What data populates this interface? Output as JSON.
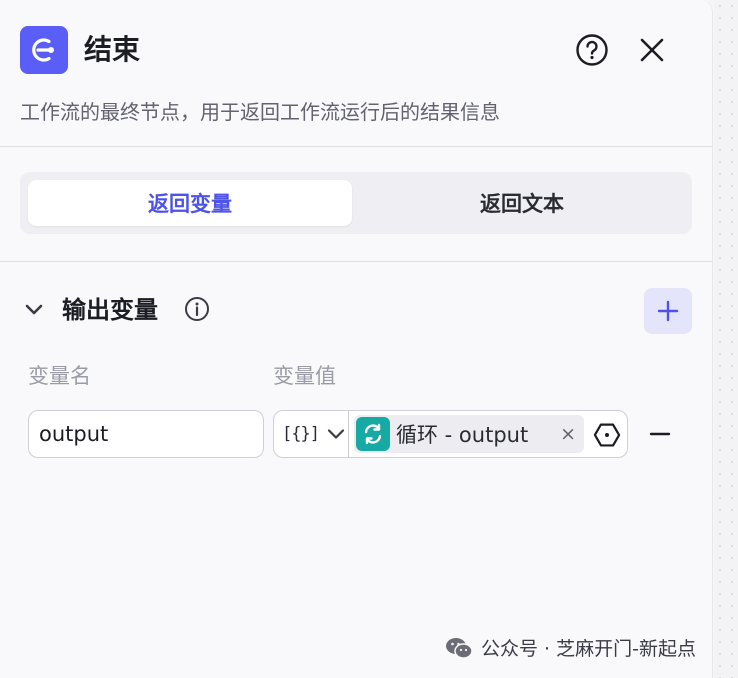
{
  "node": {
    "title": "结束",
    "description": "工作流的最终节点，用于返回工作流运行后的结果信息",
    "icon": "end-node-icon",
    "accent": "#5a5ef6"
  },
  "tabs": [
    {
      "label": "返回变量",
      "active": true
    },
    {
      "label": "返回文本",
      "active": false
    }
  ],
  "output_section": {
    "title": "输出变量",
    "columns": {
      "name": "变量名",
      "value": "变量值"
    },
    "rows": [
      {
        "name": "output",
        "type_symbol": "[{}]",
        "reference": "循环 - output",
        "reference_icon": "loop-icon",
        "reference_color": "#17a9a3"
      }
    ]
  },
  "watermark": {
    "text": "公众号 · 芝麻开门-新起点",
    "icon": "wechat-icon"
  }
}
